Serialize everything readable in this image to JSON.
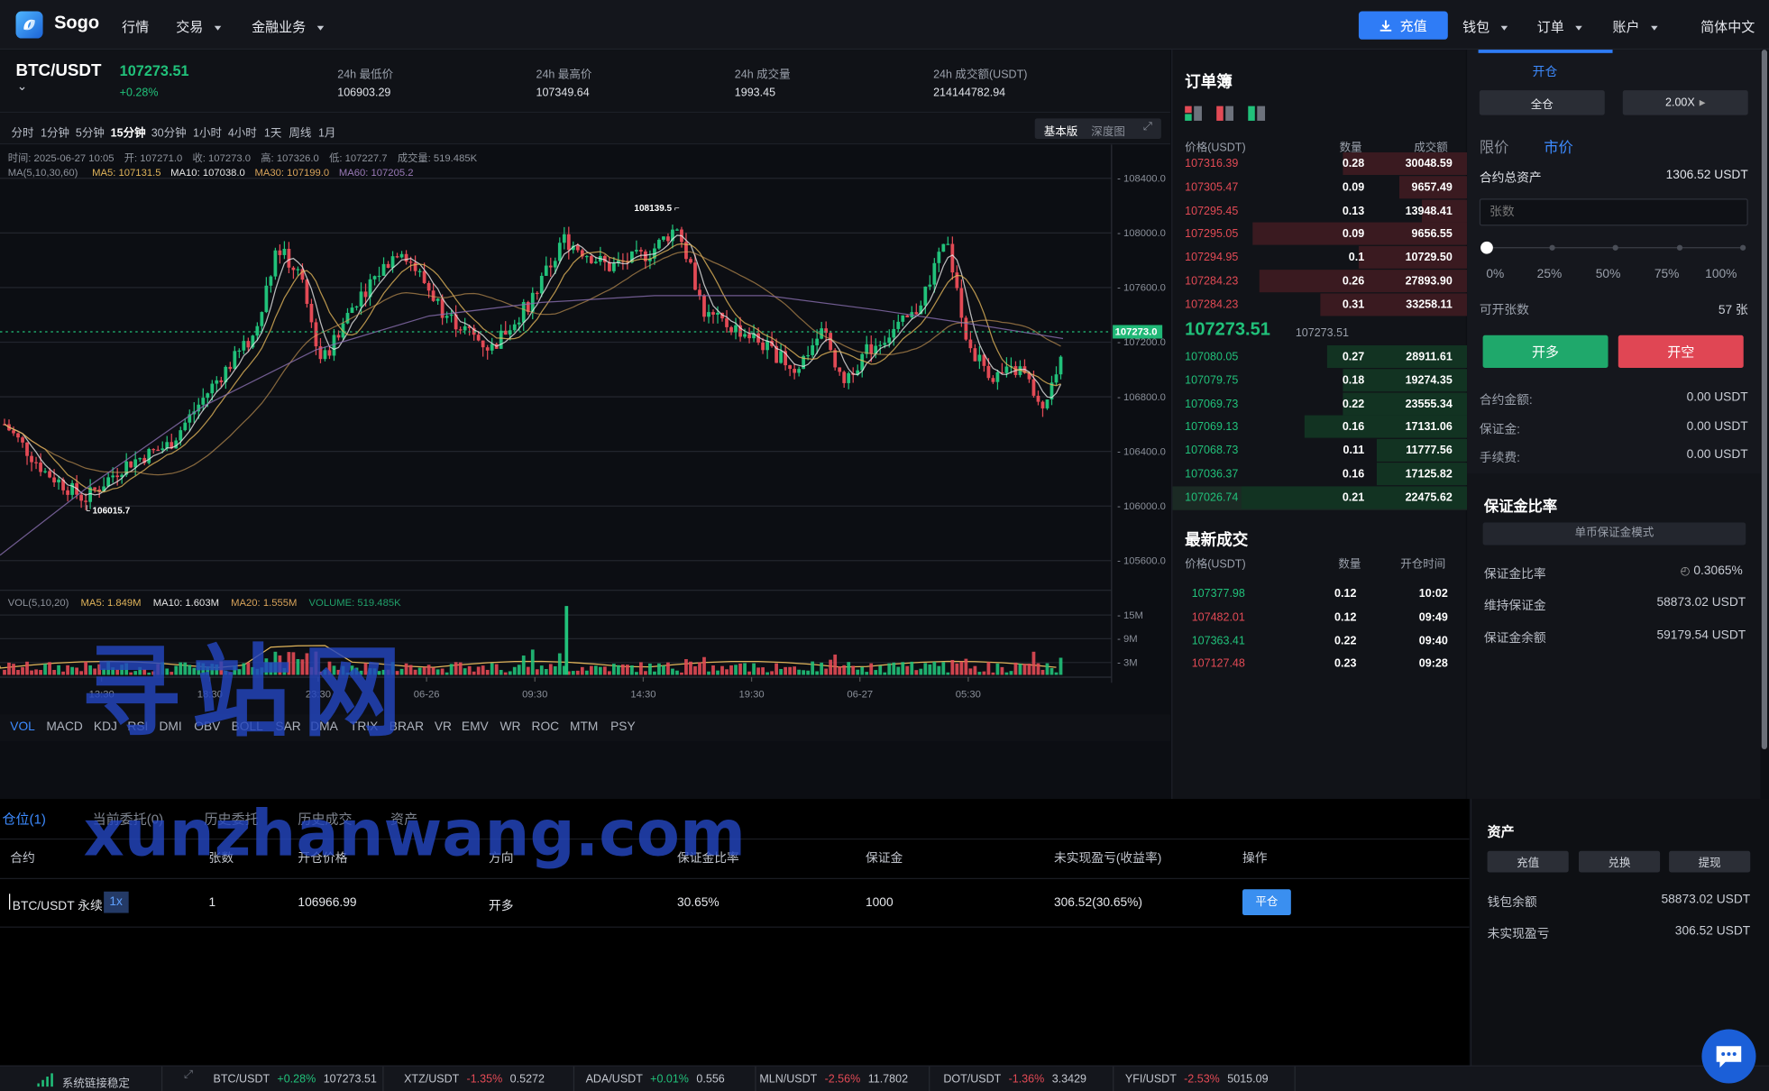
{
  "header": {
    "brand": "Sogo",
    "nav": [
      "行情",
      "交易",
      "金融业务"
    ],
    "recharge": "充值",
    "right": [
      "钱包",
      "订单",
      "账户"
    ],
    "lang": "简体中文"
  },
  "ticker": {
    "pair": "BTC/USDT",
    "price": "107273.51",
    "change": "+0.28%",
    "stats": [
      {
        "label": "24h 最低价",
        "value": "106903.29"
      },
      {
        "label": "24h 最高价",
        "value": "107349.64"
      },
      {
        "label": "24h 成交量",
        "value": "1993.45"
      },
      {
        "label": "24h 成交额(USDT)",
        "value": "214144782.94"
      }
    ]
  },
  "timeframes": [
    "分时",
    "1分钟",
    "5分钟",
    "15分钟",
    "30分钟",
    "1小时",
    "4小时",
    "1天",
    "周线",
    "1月"
  ],
  "active_timeframe": "15分钟",
  "view_modes": [
    "基本版",
    "深度图"
  ],
  "chart_info": {
    "line1": "时间: 2025-06-27 10:05　开: 107271.0　收: 107273.0　高: 107326.0　低: 107227.7　成交量: 519.485K",
    "ma_label": "MA(5,10,30,60)",
    "ma5": "MA5: 107131.5",
    "ma10": "MA10: 107038.0",
    "ma30": "MA30: 107199.0",
    "ma60": "MA60: 107205.2",
    "vol_label": "VOL(5,10,20)",
    "vma5": "MA5: 1.849M",
    "vma10": "MA10: 1.603M",
    "vma20": "MA20: 1.555M",
    "volume": "VOLUME: 519.485K"
  },
  "chart_data": {
    "type": "candlestick",
    "y_ticks": [
      "108400.0",
      "108000.0",
      "107600.0",
      "107200.0",
      "106800.0",
      "106400.0",
      "106000.0",
      "105600.0"
    ],
    "vol_ticks": [
      "15M",
      "9M",
      "3M"
    ],
    "x_ticks": [
      "13:30",
      "18:30",
      "23:30",
      "06-26",
      "09:30",
      "14:30",
      "19:30",
      "06-27",
      "05:30"
    ],
    "current_price": "107273.0",
    "max_label": "108139.5",
    "min_label": "106015.7",
    "ylim": [
      105600,
      108400
    ]
  },
  "indicators": [
    "VOL",
    "MACD",
    "KDJ",
    "RSI",
    "DMI",
    "OBV",
    "BOLL",
    "SAR",
    "DMA",
    "TRIX",
    "BRAR",
    "VR",
    "EMV",
    "WR",
    "ROC",
    "MTM",
    "PSY"
  ],
  "orderbook": {
    "title": "订单簿",
    "h_price": "价格(USDT)",
    "h_qty": "数量",
    "h_amt": "成交额",
    "asks": [
      [
        "107316.39",
        "0.28",
        "30048.59",
        0.55
      ],
      [
        "107305.47",
        "0.09",
        "9657.49",
        0.3
      ],
      [
        "107295.45",
        "0.13",
        "13948.41",
        0.2
      ],
      [
        "107295.05",
        "0.09",
        "9656.55",
        0.95
      ],
      [
        "107294.95",
        "0.1",
        "10729.50",
        0.48
      ],
      [
        "107284.23",
        "0.26",
        "27893.90",
        0.92
      ],
      [
        "107284.23",
        "0.31",
        "33258.11",
        0.65
      ]
    ],
    "mid": "107273.51",
    "mid_sub": "107273.51",
    "bids": [
      [
        "107080.05",
        "0.27",
        "28911.61",
        0.62
      ],
      [
        "107079.75",
        "0.18",
        "19274.35",
        0.55
      ],
      [
        "107069.73",
        "0.22",
        "23555.34",
        0.55
      ],
      [
        "107069.13",
        "0.16",
        "17131.06",
        0.72
      ],
      [
        "107068.73",
        "0.11",
        "11777.56",
        0.4
      ],
      [
        "107036.37",
        "0.16",
        "17125.82",
        0.4
      ],
      [
        "107026.74",
        "0.21",
        "22475.62",
        1.0
      ]
    ]
  },
  "trades": {
    "title": "最新成交",
    "h_price": "价格(USDT)",
    "h_qty": "数量",
    "h_time": "开仓时间",
    "rows": [
      [
        "107377.98",
        "0.12",
        "10:02",
        "g"
      ],
      [
        "107482.01",
        "0.12",
        "09:49",
        "r"
      ],
      [
        "107363.41",
        "0.22",
        "09:40",
        "g"
      ],
      [
        "107127.48",
        "0.23",
        "09:28",
        "r"
      ]
    ]
  },
  "trade_panel": {
    "tab_open": "开仓",
    "cross": "全仓",
    "leverage": "2.00X",
    "limit": "限价",
    "market": "市价",
    "total_label": "合约总资产",
    "total_value": "1306.52 USDT",
    "qty_placeholder": "张数",
    "pcts": [
      "0%",
      "25%",
      "50%",
      "75%",
      "100%"
    ],
    "avail_label": "可开张数",
    "avail_value": "57 张",
    "long": "开多",
    "short": "开空",
    "amount_label": "合约金额:",
    "amount": "0.00 USDT",
    "margin_label": "保证金:",
    "margin": "0.00 USDT",
    "fee_label": "手续费:",
    "fee": "0.00 USDT"
  },
  "margin_panel": {
    "title": "保证金比率",
    "mode": "单币保证金模式",
    "ratio_label": "保证金比率",
    "ratio": "0.3065%",
    "maint_label": "维持保证金",
    "maint": "58873.02 USDT",
    "bal_label": "保证金余额",
    "bal": "59179.54 USDT"
  },
  "positions": {
    "tabs": [
      "仓位(1)",
      "当前委托(0)",
      "历史委托",
      "历史成交",
      "资产"
    ],
    "headers": [
      "合约",
      "张数",
      "开仓价格",
      "方向",
      "保证金比率",
      "保证金",
      "未实现盈亏(收益率)",
      "操作"
    ],
    "row": {
      "contract": "BTC/USDT 永续",
      "lev": "1x",
      "qty": "1",
      "price": "106966.99",
      "dir": "开多",
      "ratio": "30.65%",
      "margin": "1000",
      "pnl": "306.52(30.65%)",
      "action": "平仓"
    }
  },
  "assets": {
    "title": "资产",
    "buttons": [
      "充值",
      "兑换",
      "提现"
    ],
    "wallet_label": "钱包余额",
    "wallet": "58873.02 USDT",
    "pnl_label": "未实现盈亏",
    "pnl": "306.52 USDT"
  },
  "footer": {
    "status": "系统链接稳定",
    "pairs": [
      [
        "BTC/USDT",
        "+0.28%",
        "107273.51",
        "g"
      ],
      [
        "XTZ/USDT",
        "-1.35%",
        "0.5272",
        "r"
      ],
      [
        "ADA/USDT",
        "+0.01%",
        "0.556",
        "g"
      ],
      [
        "MLN/USDT",
        "-2.56%",
        "11.7802",
        "r"
      ],
      [
        "DOT/USDT",
        "-1.36%",
        "3.3429",
        "r"
      ],
      [
        "YFI/USDT",
        "-2.53%",
        "5015.09",
        "r"
      ]
    ]
  },
  "watermark": {
    "line1": "寻站网",
    "line2": "xunzhanwang.com"
  },
  "colors": {
    "up": "#21c17a",
    "down": "#e24a55",
    "accent": "#2f7cf6"
  }
}
